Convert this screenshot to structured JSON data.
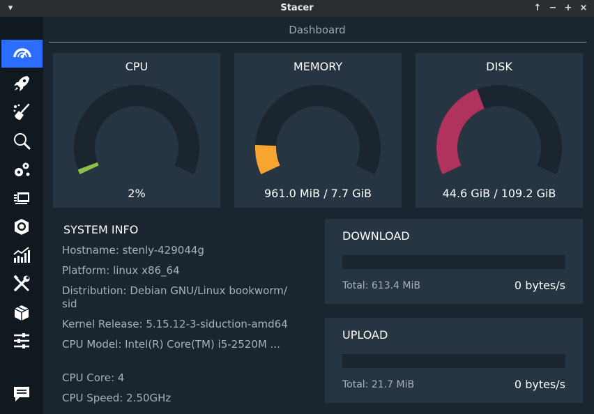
{
  "window": {
    "title": "Stacer",
    "controls": {
      "menu": "▾",
      "maximize": "↑",
      "minimize": "−",
      "restore": "+",
      "close": "×"
    }
  },
  "sidebar": {
    "items": [
      {
        "icon": "dashboard-icon",
        "active": true
      },
      {
        "icon": "rocket-icon",
        "active": false
      },
      {
        "icon": "broom-cleaner-icon",
        "active": false
      },
      {
        "icon": "search-icon",
        "active": false
      },
      {
        "icon": "gears-icon",
        "active": false
      },
      {
        "icon": "processes-icon",
        "active": false
      },
      {
        "icon": "uninstaller-icon",
        "active": false
      },
      {
        "icon": "resources-chart-icon",
        "active": false
      },
      {
        "icon": "tools-icon",
        "active": false
      },
      {
        "icon": "package-icon",
        "active": false
      },
      {
        "icon": "settings-sliders-icon",
        "active": false
      },
      {
        "icon": "feedback-icon",
        "active": false
      }
    ]
  },
  "header": {
    "title": "Dashboard"
  },
  "gauges": {
    "cpu": {
      "label": "CPU",
      "value_text": "2%",
      "fraction": 0.02,
      "color": "#8bc34a"
    },
    "memory": {
      "label": "MEMORY",
      "value_text": "961.0 MiB / 7.7 GiB",
      "fraction": 0.12,
      "color": "#f7a531"
    },
    "disk": {
      "label": "DISK",
      "value_text": "44.6 GiB / 109.2 GiB",
      "fraction": 0.41,
      "color": "#b0335e"
    }
  },
  "system_info": {
    "title": "SYSTEM INFO",
    "hostname": "Hostname: stenly-429044g",
    "platform": "Platform: linux x86_64",
    "distribution": "Distribution: Debian GNU/Linux bookworm/",
    "distribution_cont": "sid",
    "kernel": "Kernel Release: 5.15.12-3-siduction-amd64",
    "cpu_model": "CPU Model: Intel(R) Core(TM) i5-2520M ...",
    "cpu_core": "CPU Core: 4",
    "cpu_speed": "CPU Speed: 2.50GHz"
  },
  "network": {
    "download": {
      "title": "DOWNLOAD",
      "total": "Total: 613.4 MiB",
      "rate": "0 bytes/s"
    },
    "upload": {
      "title": "UPLOAD",
      "total": "Total: 21.7 MiB",
      "rate": "0 bytes/s"
    }
  },
  "colors": {
    "accent": "#2a6dff",
    "card": "#273441",
    "background": "#1b2530",
    "track": "#1b2530"
  }
}
